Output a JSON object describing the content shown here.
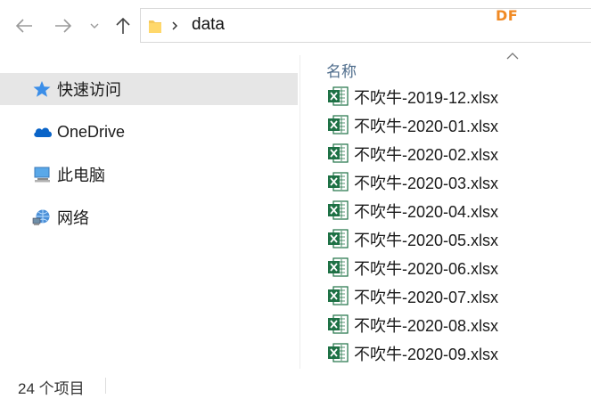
{
  "toolbar": {
    "back_icon": "arrow-left-icon",
    "forward_icon": "arrow-right-icon",
    "recent_icon": "chevron-down-icon",
    "up_icon": "arrow-up-icon"
  },
  "address_bar": {
    "folder_icon": "folder-icon",
    "separator": "›",
    "crumb": "data"
  },
  "watermark": "DF",
  "sidebar": {
    "items": [
      {
        "label": "快速访问",
        "icon": "star-icon",
        "selected": true
      },
      {
        "label": "OneDrive",
        "icon": "cloud-icon",
        "selected": false
      },
      {
        "label": "此电脑",
        "icon": "computer-icon",
        "selected": false
      },
      {
        "label": "网络",
        "icon": "network-icon",
        "selected": false
      }
    ]
  },
  "file_list": {
    "column_header": "名称",
    "sort_indicator": "ascending",
    "files": [
      {
        "name": "不吹牛-2019-12.xlsx"
      },
      {
        "name": "不吹牛-2020-01.xlsx"
      },
      {
        "name": "不吹牛-2020-02.xlsx"
      },
      {
        "name": "不吹牛-2020-03.xlsx"
      },
      {
        "name": "不吹牛-2020-04.xlsx"
      },
      {
        "name": "不吹牛-2020-05.xlsx"
      },
      {
        "name": "不吹牛-2020-06.xlsx"
      },
      {
        "name": "不吹牛-2020-07.xlsx"
      },
      {
        "name": "不吹牛-2020-08.xlsx"
      },
      {
        "name": "不吹牛-2020-09.xlsx"
      }
    ]
  },
  "status_bar": {
    "item_count": "24 个项目"
  },
  "colors": {
    "selected_bg": "#e6e6e6",
    "header_text": "#4f6d8c",
    "excel_green": "#1e7145",
    "watermark": "#f08a24"
  }
}
